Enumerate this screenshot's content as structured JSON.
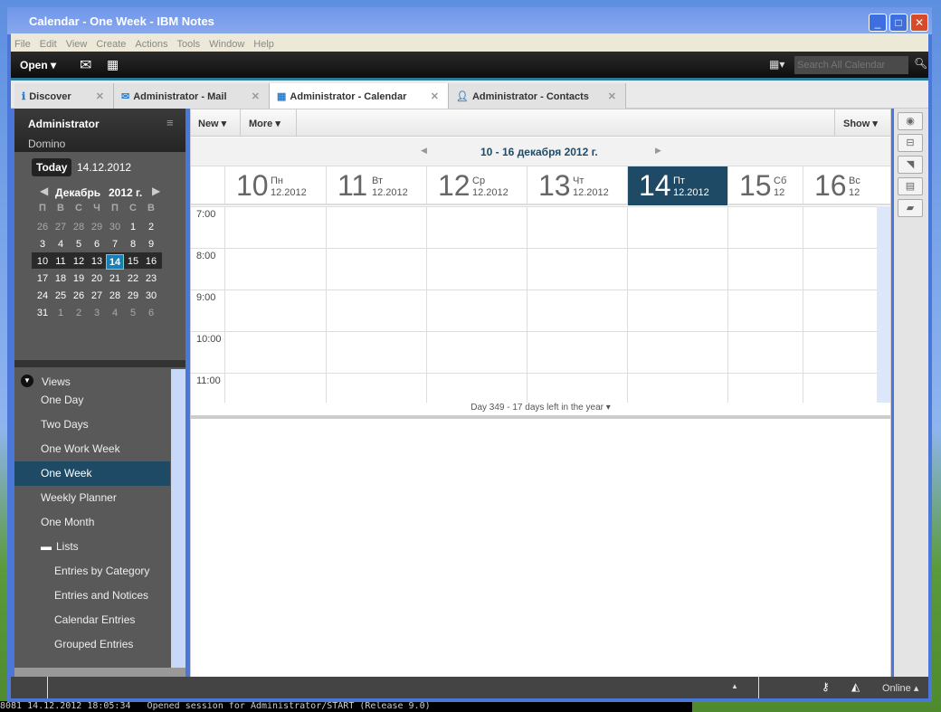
{
  "window": {
    "title": "Calendar - One Week - IBM Notes",
    "min": "_",
    "max": "□",
    "close": "✕"
  },
  "menu": [
    "File",
    "Edit",
    "View",
    "Create",
    "Actions",
    "Tools",
    "Window",
    "Help"
  ],
  "toolbar": {
    "open": "Open ▾",
    "search_placeholder": "Search All Calendar"
  },
  "tabs": [
    {
      "label": "Discover",
      "icon": "info-icon"
    },
    {
      "label": "Administrator - Mail",
      "icon": "mail-icon"
    },
    {
      "label": "Administrator - Calendar",
      "icon": "calendar-icon",
      "active": true
    },
    {
      "label": "Administrator - Contacts",
      "icon": "contact-icon"
    }
  ],
  "sidebar": {
    "user": "Administrator",
    "server": "Domino",
    "today_button": "Today",
    "today_date": "14.12.2012",
    "month": "Декабрь",
    "year": "2012 г.",
    "weekdays": [
      "П",
      "В",
      "С",
      "Ч",
      "П",
      "С",
      "В"
    ],
    "weeks": [
      [
        "26",
        "27",
        "28",
        "29",
        "30",
        "1",
        "2"
      ],
      [
        "3",
        "4",
        "5",
        "6",
        "7",
        "8",
        "9"
      ],
      [
        "10",
        "11",
        "12",
        "13",
        "14",
        "15",
        "16"
      ],
      [
        "17",
        "18",
        "19",
        "20",
        "21",
        "22",
        "23"
      ],
      [
        "24",
        "25",
        "26",
        "27",
        "28",
        "29",
        "30"
      ],
      [
        "31",
        "1",
        "2",
        "3",
        "4",
        "5",
        "6"
      ]
    ],
    "selected_day": "14",
    "views_label": "Views",
    "views": [
      "One Day",
      "Two Days",
      "One Work Week",
      "One Week",
      "Weekly Planner",
      "One Month"
    ],
    "active_view": "One Week",
    "lists_label": "Lists",
    "lists": [
      "Entries by Category",
      "Entries and Notices",
      "Calendar Entries",
      "Grouped Entries"
    ]
  },
  "actions": {
    "new": "New ▾",
    "more": "More ▾",
    "show": "Show ▾"
  },
  "range": "10 - 16 декабря 2012 г.",
  "days": [
    {
      "num": "10",
      "dow": "Пн",
      "date": "12.2012"
    },
    {
      "num": "11",
      "dow": "Вт",
      "date": "12.2012"
    },
    {
      "num": "12",
      "dow": "Ср",
      "date": "12.2012"
    },
    {
      "num": "13",
      "dow": "Чт",
      "date": "12.2012"
    },
    {
      "num": "14",
      "dow": "Пт",
      "date": "12.2012",
      "today": true
    },
    {
      "num": "15",
      "dow": "Сб",
      "date": "12"
    },
    {
      "num": "16",
      "dow": "Вс",
      "date": "12"
    }
  ],
  "hours": [
    "7:00",
    "8:00",
    "9:00",
    "10:00",
    "11:00"
  ],
  "footer": "Day 349 - 17 days left in the year ▾",
  "status": {
    "online": "Online ▴"
  },
  "console": "8081 14.12.2012 18:05:34   Opened session for Administrator/START (Release 9.0)",
  "colors": {
    "accent": "#1e4a66",
    "today_blue": "#1a7fb5"
  }
}
